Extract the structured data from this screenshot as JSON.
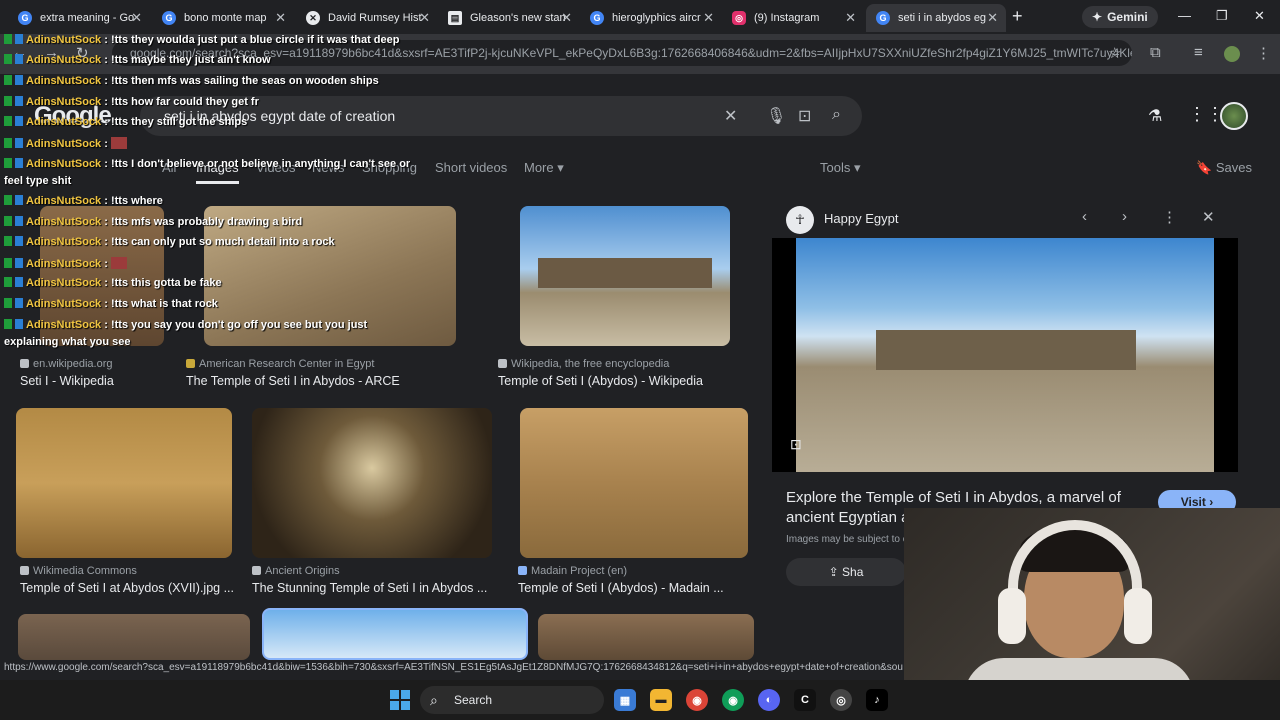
{
  "browser": {
    "tabs": [
      {
        "label": "extra meaning - Go",
        "icon": "google-icon",
        "color": "#4285f4"
      },
      {
        "label": "bono monte map",
        "icon": "google-icon",
        "color": "#4285f4"
      },
      {
        "label": "David Rumsey Hist",
        "icon": "map-icon",
        "color": "#e8eaed"
      },
      {
        "label": "Gleason's new stan",
        "icon": "doc-icon",
        "color": "#e8eaed"
      },
      {
        "label": "hieroglyphics aircr",
        "icon": "google-icon",
        "color": "#4285f4"
      },
      {
        "label": "(9) Instagram",
        "icon": "instagram-icon",
        "color": "#e1306c"
      },
      {
        "label": "seti i in abydos eg",
        "icon": "google-icon",
        "color": "#4285f4"
      }
    ],
    "new_tab": "+",
    "gemini": "Gemini",
    "url": "google.com/search?sca_esv=a19118979b6bc41d&sxsrf=AE3TifP2j-kjcuNKeVPL_ekPeQyDxL6B3g:1762668406846&udm=2&fbs=AIIjpHxU7SXXniUZfeShr2fp4giZ1Y6MJ25_tmWITc7uy4Kleu...",
    "status_url": "https://www.google.com/search?sca_esv=a19118979b6bc41d&biw=1536&bih=730&sxsrf=AE3TifNSN_ES1Eg5tAsJgEt1Z8DNfMJG7Q:1762668434812&q=seti+i+in+abydos+egypt+date+of+creation&sou"
  },
  "google": {
    "logo": "Google",
    "query": "seti i in abydos egypt date of creation",
    "nav": {
      "all": "All",
      "images": "Images",
      "videos": "Videos",
      "news": "News",
      "shopping": "Shopping",
      "short_videos": "Short videos",
      "more": "More",
      "tools": "Tools",
      "saves": "Saves"
    },
    "results": [
      {
        "source": "en.wikipedia.org",
        "title": "Seti I - Wikipedia"
      },
      {
        "source": "American Research Center in Egypt",
        "title": "The Temple of Seti I in Abydos - ARCE"
      },
      {
        "source": "Wikipedia, the free encyclopedia",
        "title": "Temple of Seti I (Abydos) - Wikipedia"
      },
      {
        "source": "Wikimedia Commons",
        "title": "Temple of Seti I at Abydos (XVII).jpg ..."
      },
      {
        "source": "Ancient Origins",
        "title": "The Stunning Temple of Seti I in Abydos ..."
      },
      {
        "source": "Madain Project (en)",
        "title": "Temple of Seti I (Abydos) - Madain ..."
      }
    ],
    "panel": {
      "source": "Happy Egypt",
      "title": "Explore the Temple of Seti I in Abydos, a marvel of ancient Egyptian a",
      "visit": "Visit ›",
      "copyright": "Images may be subject to c",
      "share": "Sha"
    }
  },
  "chat": [
    {
      "name": "AdinsNutSock",
      "msg": ": !tts they woulda just put a blue circle if it was that deep"
    },
    {
      "name": "AdinsNutSock",
      "msg": ": !tts maybe they just ain't know"
    },
    {
      "name": "AdinsNutSock",
      "msg": ": !tts then mfs was sailing the seas on wooden ships"
    },
    {
      "name": "AdinsNutSock",
      "msg": ": !tts how far could they get fr"
    },
    {
      "name": "AdinsNutSock",
      "msg": ": !tts they still got the ships"
    },
    {
      "name": "AdinsNutSock",
      "msg": ":"
    },
    {
      "name": "AdinsNutSock",
      "msg": ": !tts I don't believe or not believe in anything I can't see or"
    },
    {
      "name": "",
      "msg": "feel type shit"
    },
    {
      "name": "AdinsNutSock",
      "msg": ": !tts where"
    },
    {
      "name": "AdinsNutSock",
      "msg": ": !tts mfs was probably drawing a bird"
    },
    {
      "name": "AdinsNutSock",
      "msg": ": !tts can only put so much detail into a rock"
    },
    {
      "name": "AdinsNutSock",
      "msg": ":"
    },
    {
      "name": "AdinsNutSock",
      "msg": ": !tts this gotta be fake"
    },
    {
      "name": "AdinsNutSock",
      "msg": ": !tts what is that rock"
    },
    {
      "name": "AdinsNutSock",
      "msg": ": !tts you say you don't go off you see but you just"
    },
    {
      "name": "",
      "msg": "explaining what you see"
    }
  ],
  "taskbar": {
    "search": "Search"
  },
  "colors": {
    "background": "#202124",
    "accent": "#8ab4f8",
    "chat_name": "#f0c541"
  }
}
